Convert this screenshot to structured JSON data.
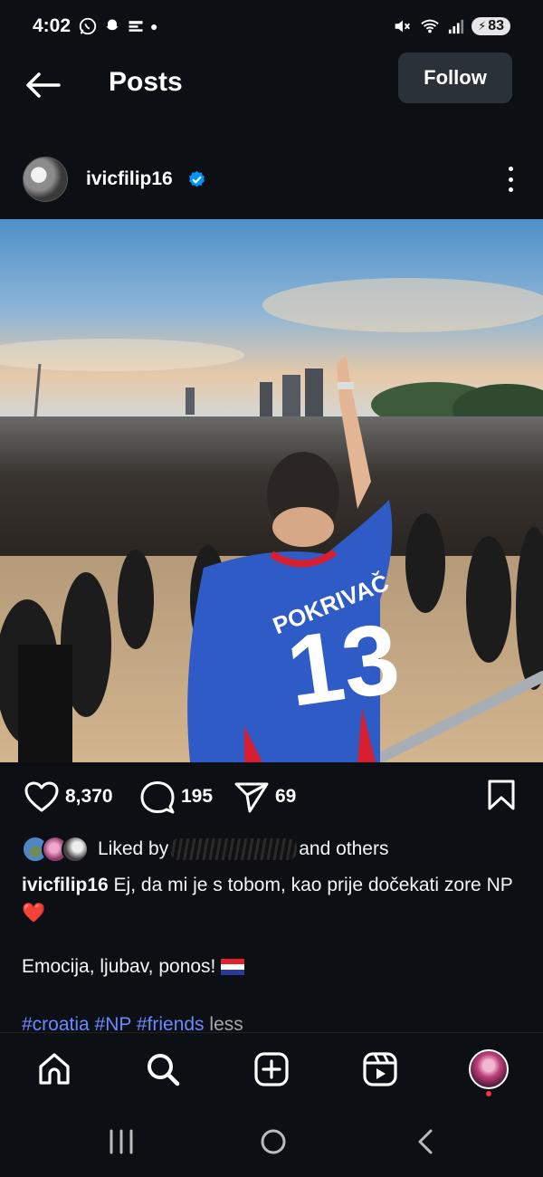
{
  "status_bar": {
    "time": "4:02",
    "battery": "83"
  },
  "header": {
    "title": "Posts",
    "follow_label": "Follow"
  },
  "post": {
    "username": "ivicfilip16",
    "verified": true,
    "photo_jersey_name": "POKRIVAČ",
    "photo_jersey_number": "13",
    "likes": "8,370",
    "comments": "195",
    "shares": "69",
    "liked_by_prefix": "Liked by",
    "liked_by_suffix": "and others",
    "caption_username": "ivicfilip16",
    "caption_text": " Ej, da mi je s tobom, kao prije dočekati zore NP",
    "caption_emoji": "❤️",
    "caption_line2": "Emocija, ljubav, ponos!",
    "caption_line2_flag": "🇭🇷",
    "hashtags": "#croatia #NP #friends",
    "less_label": "less"
  },
  "colors": {
    "background": "#0c1014",
    "accent_blue": "#0095f6",
    "hashtag_blue": "#6c88ff",
    "follow_button": "#2a3138"
  },
  "icons": {
    "back": "arrow-left-icon",
    "more": "more-vertical-icon",
    "like": "heart-icon",
    "comment": "comment-bubble-icon",
    "share": "paper-plane-icon",
    "save": "bookmark-icon",
    "nav": [
      "home-icon",
      "search-icon",
      "create-plus-icon",
      "reels-icon",
      "profile-avatar"
    ]
  }
}
